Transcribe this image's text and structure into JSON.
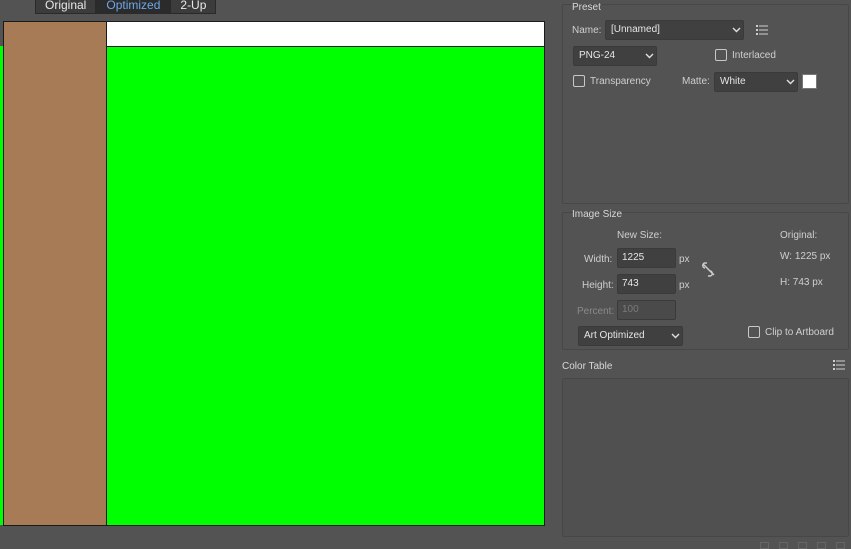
{
  "tabs": [
    {
      "label": "Original"
    },
    {
      "label": "Optimized"
    },
    {
      "label": "2-Up"
    }
  ],
  "preview": {
    "colors": {
      "brown": "#a77b56",
      "green": "#00ff00",
      "white": "#ffffff"
    }
  },
  "preset": {
    "title": "Preset",
    "name_label": "Name:",
    "name_value": "[Unnamed]",
    "format_value": "PNG-24",
    "interlaced_label": "Interlaced",
    "transparency_label": "Transparency",
    "matte_label": "Matte:",
    "matte_value": "White",
    "matte_color": "#ffffff"
  },
  "image_size": {
    "title": "Image Size",
    "new_size_label": "New Size:",
    "original_label": "Original:",
    "width_label": "Width:",
    "width_value": "1225",
    "height_label": "Height:",
    "height_value": "743",
    "unit": "px",
    "percent_label": "Percent:",
    "percent_value": "100",
    "orig_w": "W:  1225 px",
    "orig_h": "H:  743 px",
    "quality_value": "Art Optimized",
    "clip_label": "Clip to Artboard"
  },
  "color_table": {
    "title": "Color Table"
  },
  "icons": {
    "menu": "list-menu-icon",
    "link": "unlink-icon",
    "chevron": "chevron-down-icon"
  }
}
